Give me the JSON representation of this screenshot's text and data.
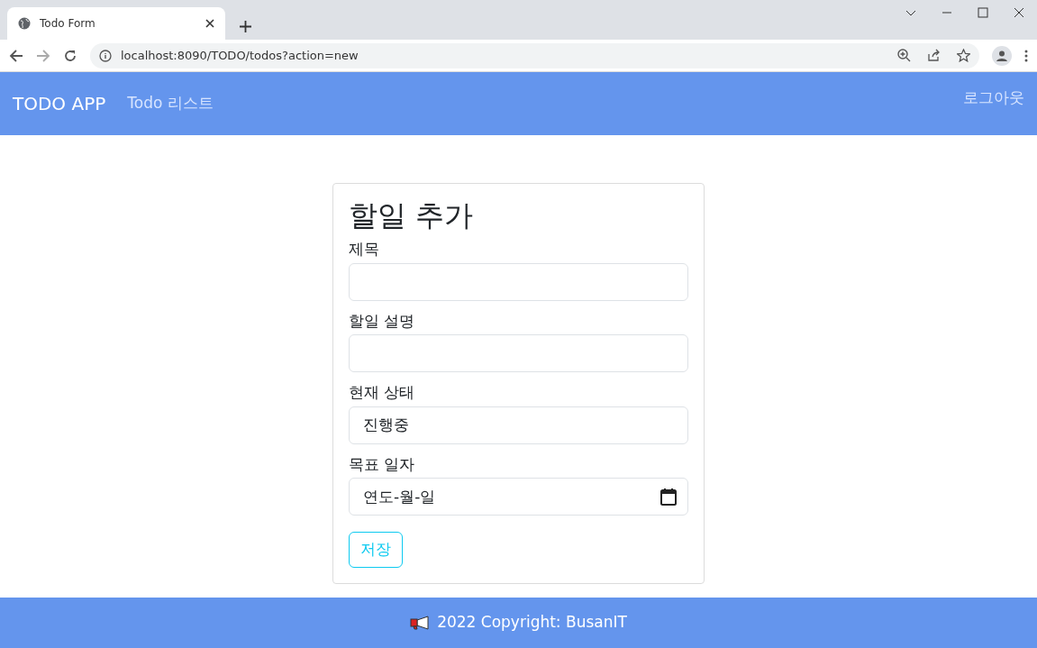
{
  "browser": {
    "tab_title": "Todo Form",
    "url": "localhost:8090/TODO/todos?action=new"
  },
  "navbar": {
    "brand": "TODO APP",
    "links": [
      {
        "label": "Todo 리스트"
      }
    ],
    "right_link": "로그아웃"
  },
  "form": {
    "title": "할일 추가",
    "fields": [
      {
        "kind": "text",
        "label": "제목"
      },
      {
        "kind": "text",
        "label": "할일 설명"
      },
      {
        "kind": "text",
        "label": "현재 상태",
        "value": "진행중"
      },
      {
        "kind": "date",
        "label": "목표 일자",
        "value": "연도-월-일"
      }
    ],
    "submit": "저장"
  },
  "footer": {
    "text": "2022 Copyright: BusanIT"
  }
}
